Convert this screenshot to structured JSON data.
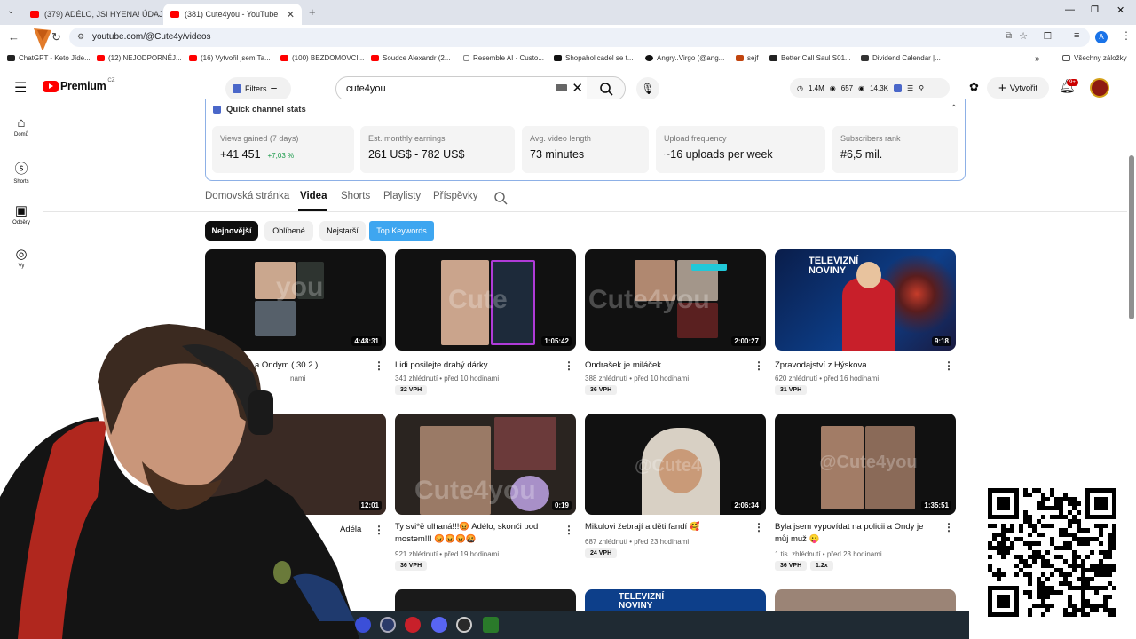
{
  "browser": {
    "tabs": [
      {
        "title": "(379) ADÉLO, JSI HYENA! ÚDAJ",
        "active": false
      },
      {
        "title": "(381) Cute4you - YouTube",
        "active": true
      }
    ],
    "new_tab_symbol": "+",
    "url": "youtube.com/@Cute4y/videos",
    "bookmarks": [
      "ChatGPT - Keto Jíde...",
      "(12) NEJODPORNĚJ...",
      "(16) Vytvořil jsem Ta...",
      "(100) BEZDOMOVCI...",
      "Soudce Alexandr (2...",
      "Resemble AI - Custo...",
      "Shopaholicadel se t...",
      "Angry..Virgo (@ang...",
      "sejf",
      "Better Call Saul S01...",
      "Dividend Calendar |..."
    ],
    "all_bookmarks": "Všechny záložky",
    "profile_letter": "A"
  },
  "youtube": {
    "logo_text": "Premium",
    "logo_region": "CZ",
    "filters_label": "Filters",
    "search_value": "cute4you",
    "ext_stats": {
      "a": "1.4M",
      "b": "657",
      "c": "14.3K"
    },
    "create_label": "Vytvořit",
    "notif_badge": "9+",
    "sidebar": [
      {
        "label": "Domů",
        "icon": "home-icon"
      },
      {
        "label": "Shorts",
        "icon": "shorts-icon"
      },
      {
        "label": "Odběry",
        "icon": "subscriptions-icon"
      },
      {
        "label": "Vy",
        "icon": "you-icon"
      }
    ],
    "quick_stats": {
      "title": "Quick channel stats",
      "cards": [
        {
          "label": "Views gained (7 days)",
          "value": "+41 451",
          "delta": "+7,03 %"
        },
        {
          "label": "Est. monthly earnings",
          "value": "261 US$ - 782 US$"
        },
        {
          "label": "Avg. video length",
          "value": "73 minutes"
        },
        {
          "label": "Upload frequency",
          "value": "~16 uploads per week"
        },
        {
          "label": "Subscribers rank",
          "value": "#6,5 mil."
        }
      ]
    },
    "channel_tabs": [
      "Domovská stránka",
      "Videa",
      "Shorts",
      "Playlisty",
      "Příspěvky"
    ],
    "active_tab": "Videa",
    "chips": [
      "Nejnovější",
      "Oblíbené",
      "Nejstarší",
      "Top Keywords"
    ],
    "videos": [
      {
        "title": "a Ondym ( 30.2.)",
        "meta": "nami",
        "duration": "4:48:31",
        "vph": ""
      },
      {
        "title": "Lidi posilejte drahý dárky",
        "meta": "341 zhlédnutí • před 10 hodinami",
        "duration": "1:05:42",
        "vph": "32 VPH"
      },
      {
        "title": "Ondrašek je miláček",
        "meta": "388 zhlédnutí • před 10 hodinami",
        "duration": "2:00:27",
        "vph": "36 VPH"
      },
      {
        "title": "Zpravodajství z Hýskova",
        "meta": "620 zhlédnutí • před 16 hodinami",
        "duration": "9:18",
        "vph": "31 VPH",
        "news_title": "TELEVIZNÍ NOVINY"
      },
      {
        "title": "Adéla",
        "meta": "",
        "duration": "12:01",
        "vph": ""
      },
      {
        "title": "Ty svi*ě ulhaná!!!😡 Adélo, skonči pod mostem!!! 😡😡😡🤬",
        "meta": "921 zhlédnutí • před 19 hodinami",
        "duration": "0:19",
        "vph": "36 VPH"
      },
      {
        "title": "Mikulovi žebrají a děti fandí 🥰",
        "meta": "687 zhlédnutí • před 23 hodinami",
        "duration": "2:06:34",
        "vph": "24 VPH"
      },
      {
        "title": "Byla jsem vypovídat na policii a Ondy je můj muž 😛",
        "meta": "1 tis. zhlédnutí • před 23 hodinami",
        "duration": "1:35:51",
        "vph": "36 VPH",
        "vph2": "1.2x"
      }
    ],
    "watermark": "Cute4you",
    "bottom_news_title": "TELEVIZNÍ NOVINY"
  }
}
